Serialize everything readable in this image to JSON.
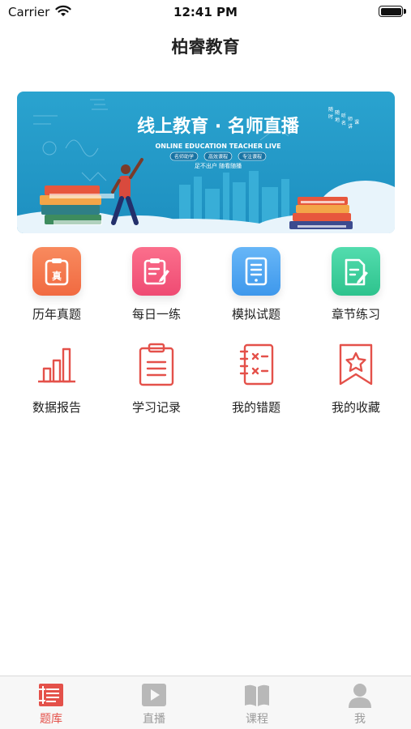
{
  "status_bar": {
    "carrier": "Carrier",
    "time": "12:41 PM",
    "battery_level": 1.0
  },
  "nav": {
    "title": "柏睿教育"
  },
  "banner": {
    "headline": "线上教育 · 名师直播",
    "subtitle": "ONLINE EDUCATION TEACHER LIVE",
    "tags": [
      "名师助学",
      "高效课程",
      "专注课程"
    ],
    "caption": "足不出户 随看随播",
    "vertical_text": [
      "随",
      "时",
      "随",
      "地",
      "听",
      "名",
      "师",
      "讲",
      "课"
    ]
  },
  "grid": {
    "row1": [
      {
        "label": "历年真题",
        "icon": "past-exams-icon",
        "color": "#f4774e"
      },
      {
        "label": "每日一练",
        "icon": "daily-practice-icon",
        "color": "#f45a7d"
      },
      {
        "label": "模拟试题",
        "icon": "mock-test-icon",
        "color": "#4ea6f2"
      },
      {
        "label": "章节练习",
        "icon": "chapter-practice-icon",
        "color": "#3fcf9e"
      }
    ],
    "row2": [
      {
        "label": "数据报告",
        "icon": "bar-chart-icon"
      },
      {
        "label": "学习记录",
        "icon": "clipboard-icon"
      },
      {
        "label": "我的错题",
        "icon": "wrong-questions-icon"
      },
      {
        "label": "我的收藏",
        "icon": "bookmark-star-icon"
      }
    ],
    "line_icon_color": "#e4514a"
  },
  "tab_bar": {
    "tabs": [
      {
        "label": "题库",
        "icon": "question-bank-icon",
        "active": true
      },
      {
        "label": "直播",
        "icon": "play-icon",
        "active": false
      },
      {
        "label": "课程",
        "icon": "book-icon",
        "active": false
      },
      {
        "label": "我",
        "icon": "person-icon",
        "active": false
      }
    ],
    "active_color": "#e4514a",
    "inactive_color": "#b0b0b0"
  }
}
